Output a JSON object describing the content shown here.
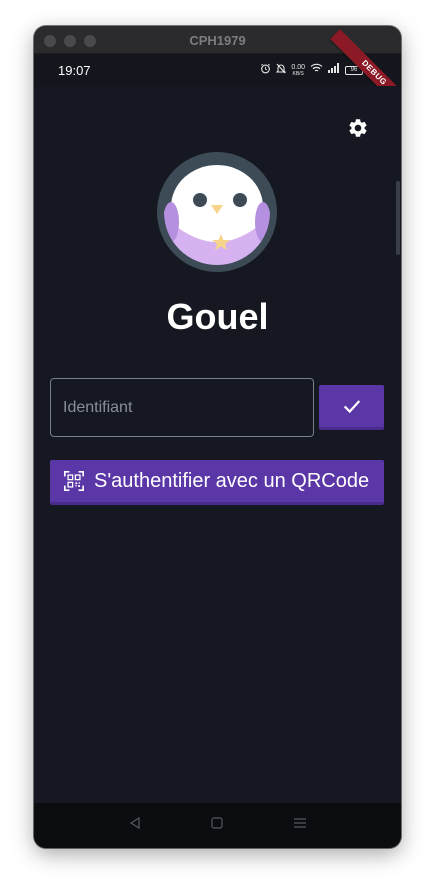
{
  "window": {
    "title": "CPH1979"
  },
  "status_bar": {
    "time": "19:07",
    "net_speed_value": "0.00",
    "net_speed_unit": "KB/S",
    "battery": "96",
    "icons": [
      "alarm-icon",
      "mute-icon",
      "net-speed",
      "wifi-icon",
      "signal-icon",
      "battery-icon"
    ]
  },
  "debug_banner": "DEBUG",
  "app": {
    "title": "Gouel"
  },
  "login": {
    "id_placeholder": "Identifiant",
    "id_value": "",
    "qr_button_label": "S'authentifier avec un QRCode"
  },
  "colors": {
    "background": "#151820",
    "accent": "#5b36a6",
    "avatar_ring": "#3d4b57",
    "mascot_body": "#d6b3f0"
  },
  "nav": {
    "icons": [
      "back-icon",
      "home-icon",
      "menu-icon"
    ]
  }
}
